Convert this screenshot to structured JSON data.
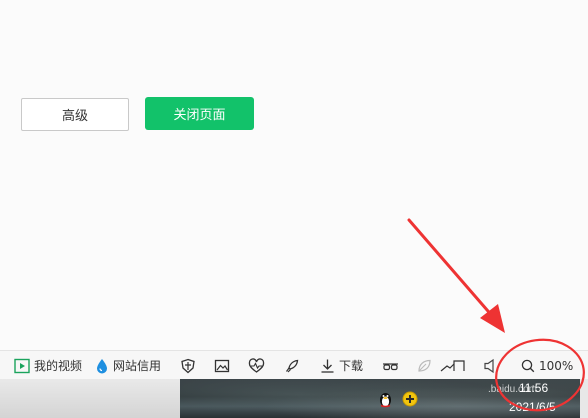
{
  "page": {
    "advanced_label": "高级",
    "close_page_label": "关闭页面"
  },
  "statusbar": {
    "my_video": "我的视频",
    "site_credit": "网站信用",
    "download": "下载",
    "zoom": "100%"
  },
  "taskbar": {
    "time": "11:56",
    "date": "2021/6/5",
    "watermark": ".baidu.com"
  },
  "colors": {
    "accent_green": "#12c26a",
    "annotation_red": "#ee3333"
  },
  "icons": [
    "play-icon",
    "drop-icon",
    "shield-icon",
    "image-icon",
    "heart-pulse-icon",
    "rocket-icon",
    "download-icon",
    "glasses-icon",
    "leaf-icon",
    "chart-icon",
    "speaker-icon",
    "zoom-icon",
    "qq-penguin-icon",
    "plus-badge-icon"
  ]
}
